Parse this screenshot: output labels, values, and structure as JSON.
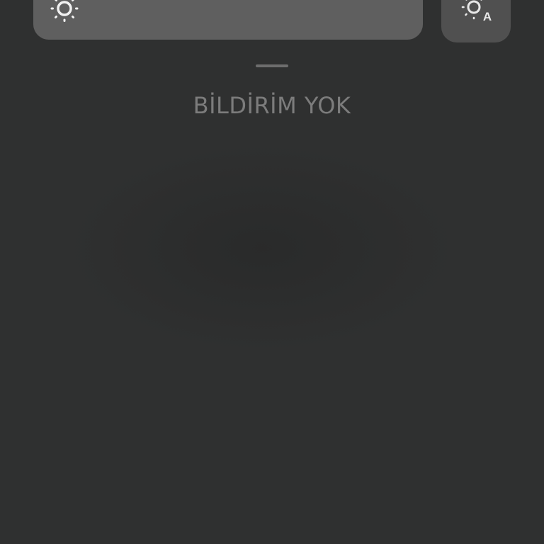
{
  "quick_panel": {
    "brightness": {
      "level": 1.0,
      "icon": "sun-icon"
    },
    "auto_brightness": {
      "icon": "sun-auto-icon",
      "badge": "A"
    }
  },
  "notifications": {
    "empty_text": "BİLDİRİM YOK"
  },
  "colors": {
    "background": "#2f3030",
    "slider_fill": "#5f5f5f",
    "slider_track": "#4a4a4a",
    "text": "#7c7c7c"
  }
}
